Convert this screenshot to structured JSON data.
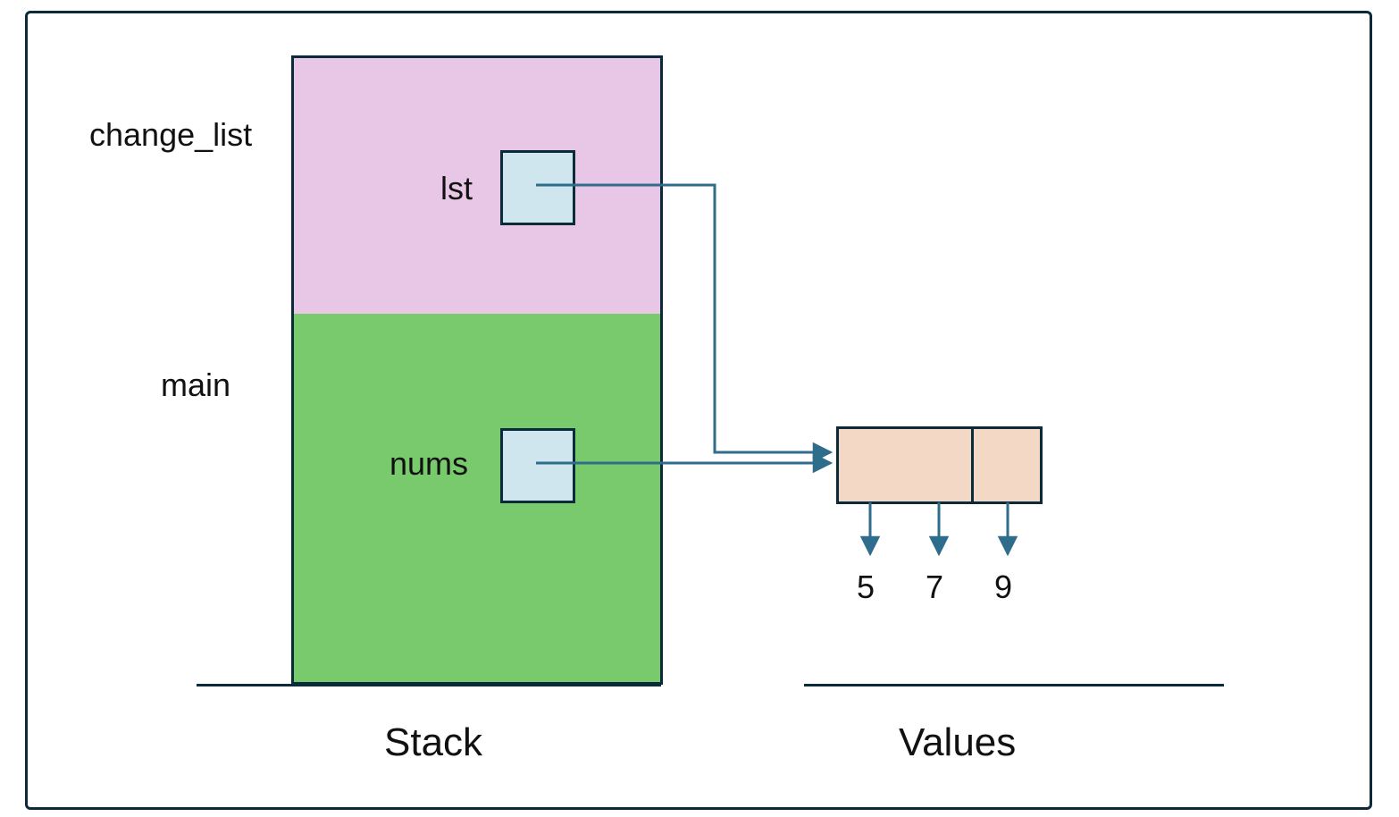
{
  "diagram": {
    "frames": [
      {
        "name": "change_list",
        "vars": [
          {
            "label": "lst"
          }
        ]
      },
      {
        "name": "main",
        "vars": [
          {
            "label": "nums"
          }
        ]
      }
    ],
    "stack_label": "Stack",
    "values_label": "Values",
    "list_values": [
      "5",
      "7",
      "9"
    ],
    "colors": {
      "frame": "#0b2a3a",
      "stack_top_bg": "#e8c6e6",
      "stack_bot_bg": "#79c96d",
      "varbox_bg": "#cfe6ef",
      "cell_bg": "#f4d8c6",
      "arrow": "#2f6d8c"
    }
  }
}
